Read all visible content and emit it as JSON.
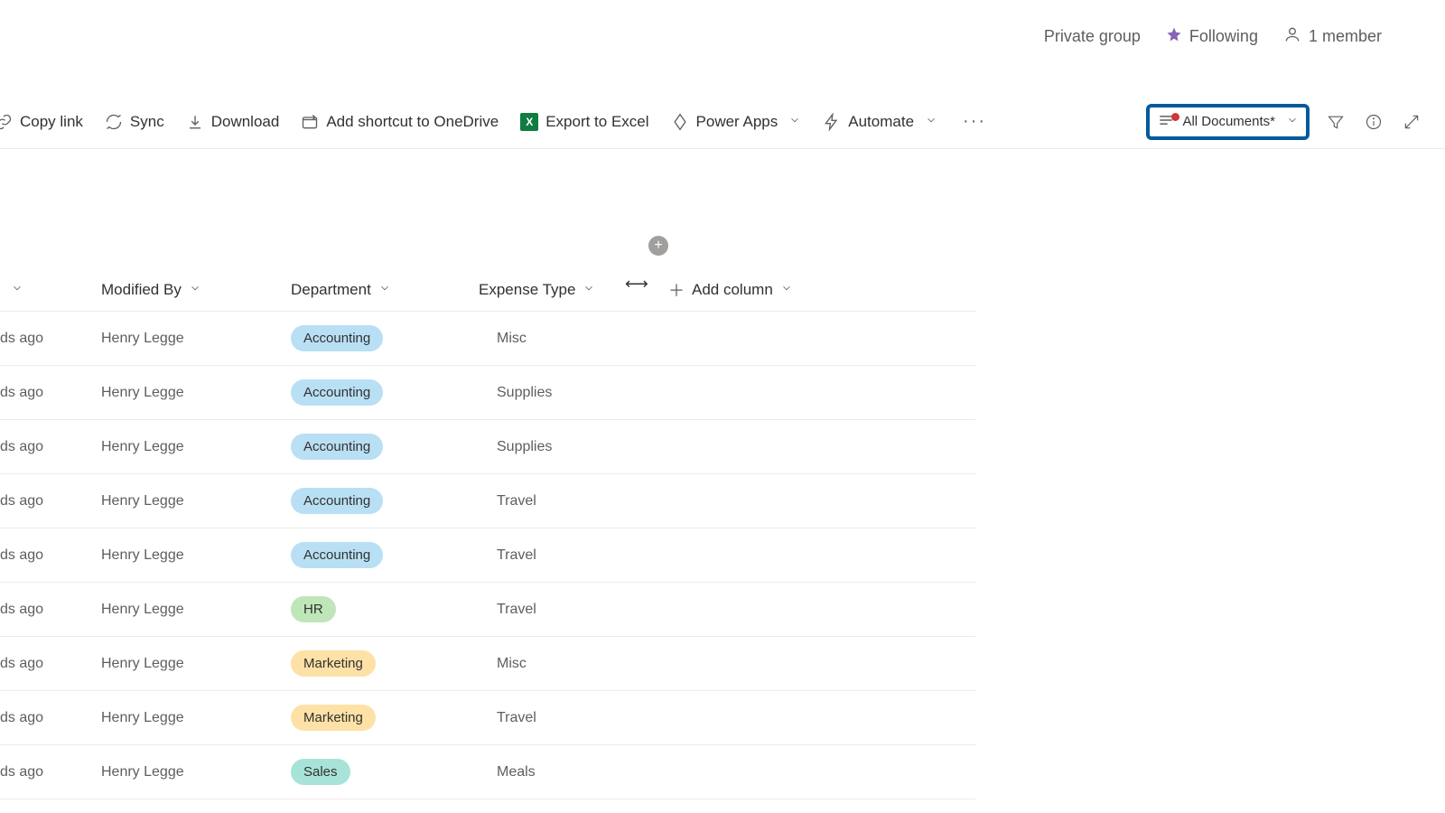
{
  "group_info": {
    "privacy": "Private group",
    "following": "Following",
    "members": "1 member"
  },
  "command_bar": {
    "copy_link": "Copy link",
    "sync": "Sync",
    "download": "Download",
    "add_shortcut": "Add shortcut to OneDrive",
    "export_excel": "Export to Excel",
    "power_apps": "Power Apps",
    "automate": "Automate"
  },
  "view": {
    "name": "All Documents*"
  },
  "columns": {
    "modified_chev_only": "",
    "modified_by": "Modified By",
    "department": "Department",
    "expense_type": "Expense Type",
    "add_column": "Add column"
  },
  "rows": [
    {
      "modified": "ds ago",
      "modified_by": "Henry Legge",
      "department": "Accounting",
      "dept_class": "accounting",
      "expense_type": "Misc"
    },
    {
      "modified": "ds ago",
      "modified_by": "Henry Legge",
      "department": "Accounting",
      "dept_class": "accounting",
      "expense_type": "Supplies"
    },
    {
      "modified": "ds ago",
      "modified_by": "Henry Legge",
      "department": "Accounting",
      "dept_class": "accounting",
      "expense_type": "Supplies"
    },
    {
      "modified": "ds ago",
      "modified_by": "Henry Legge",
      "department": "Accounting",
      "dept_class": "accounting",
      "expense_type": "Travel"
    },
    {
      "modified": "ds ago",
      "modified_by": "Henry Legge",
      "department": "Accounting",
      "dept_class": "accounting",
      "expense_type": "Travel"
    },
    {
      "modified": "ds ago",
      "modified_by": "Henry Legge",
      "department": "HR",
      "dept_class": "hr",
      "expense_type": "Travel"
    },
    {
      "modified": "ds ago",
      "modified_by": "Henry Legge",
      "department": "Marketing",
      "dept_class": "marketing",
      "expense_type": "Misc"
    },
    {
      "modified": "ds ago",
      "modified_by": "Henry Legge",
      "department": "Marketing",
      "dept_class": "marketing",
      "expense_type": "Travel"
    },
    {
      "modified": "ds ago",
      "modified_by": "Henry Legge",
      "department": "Sales",
      "dept_class": "sales",
      "expense_type": "Meals"
    }
  ]
}
